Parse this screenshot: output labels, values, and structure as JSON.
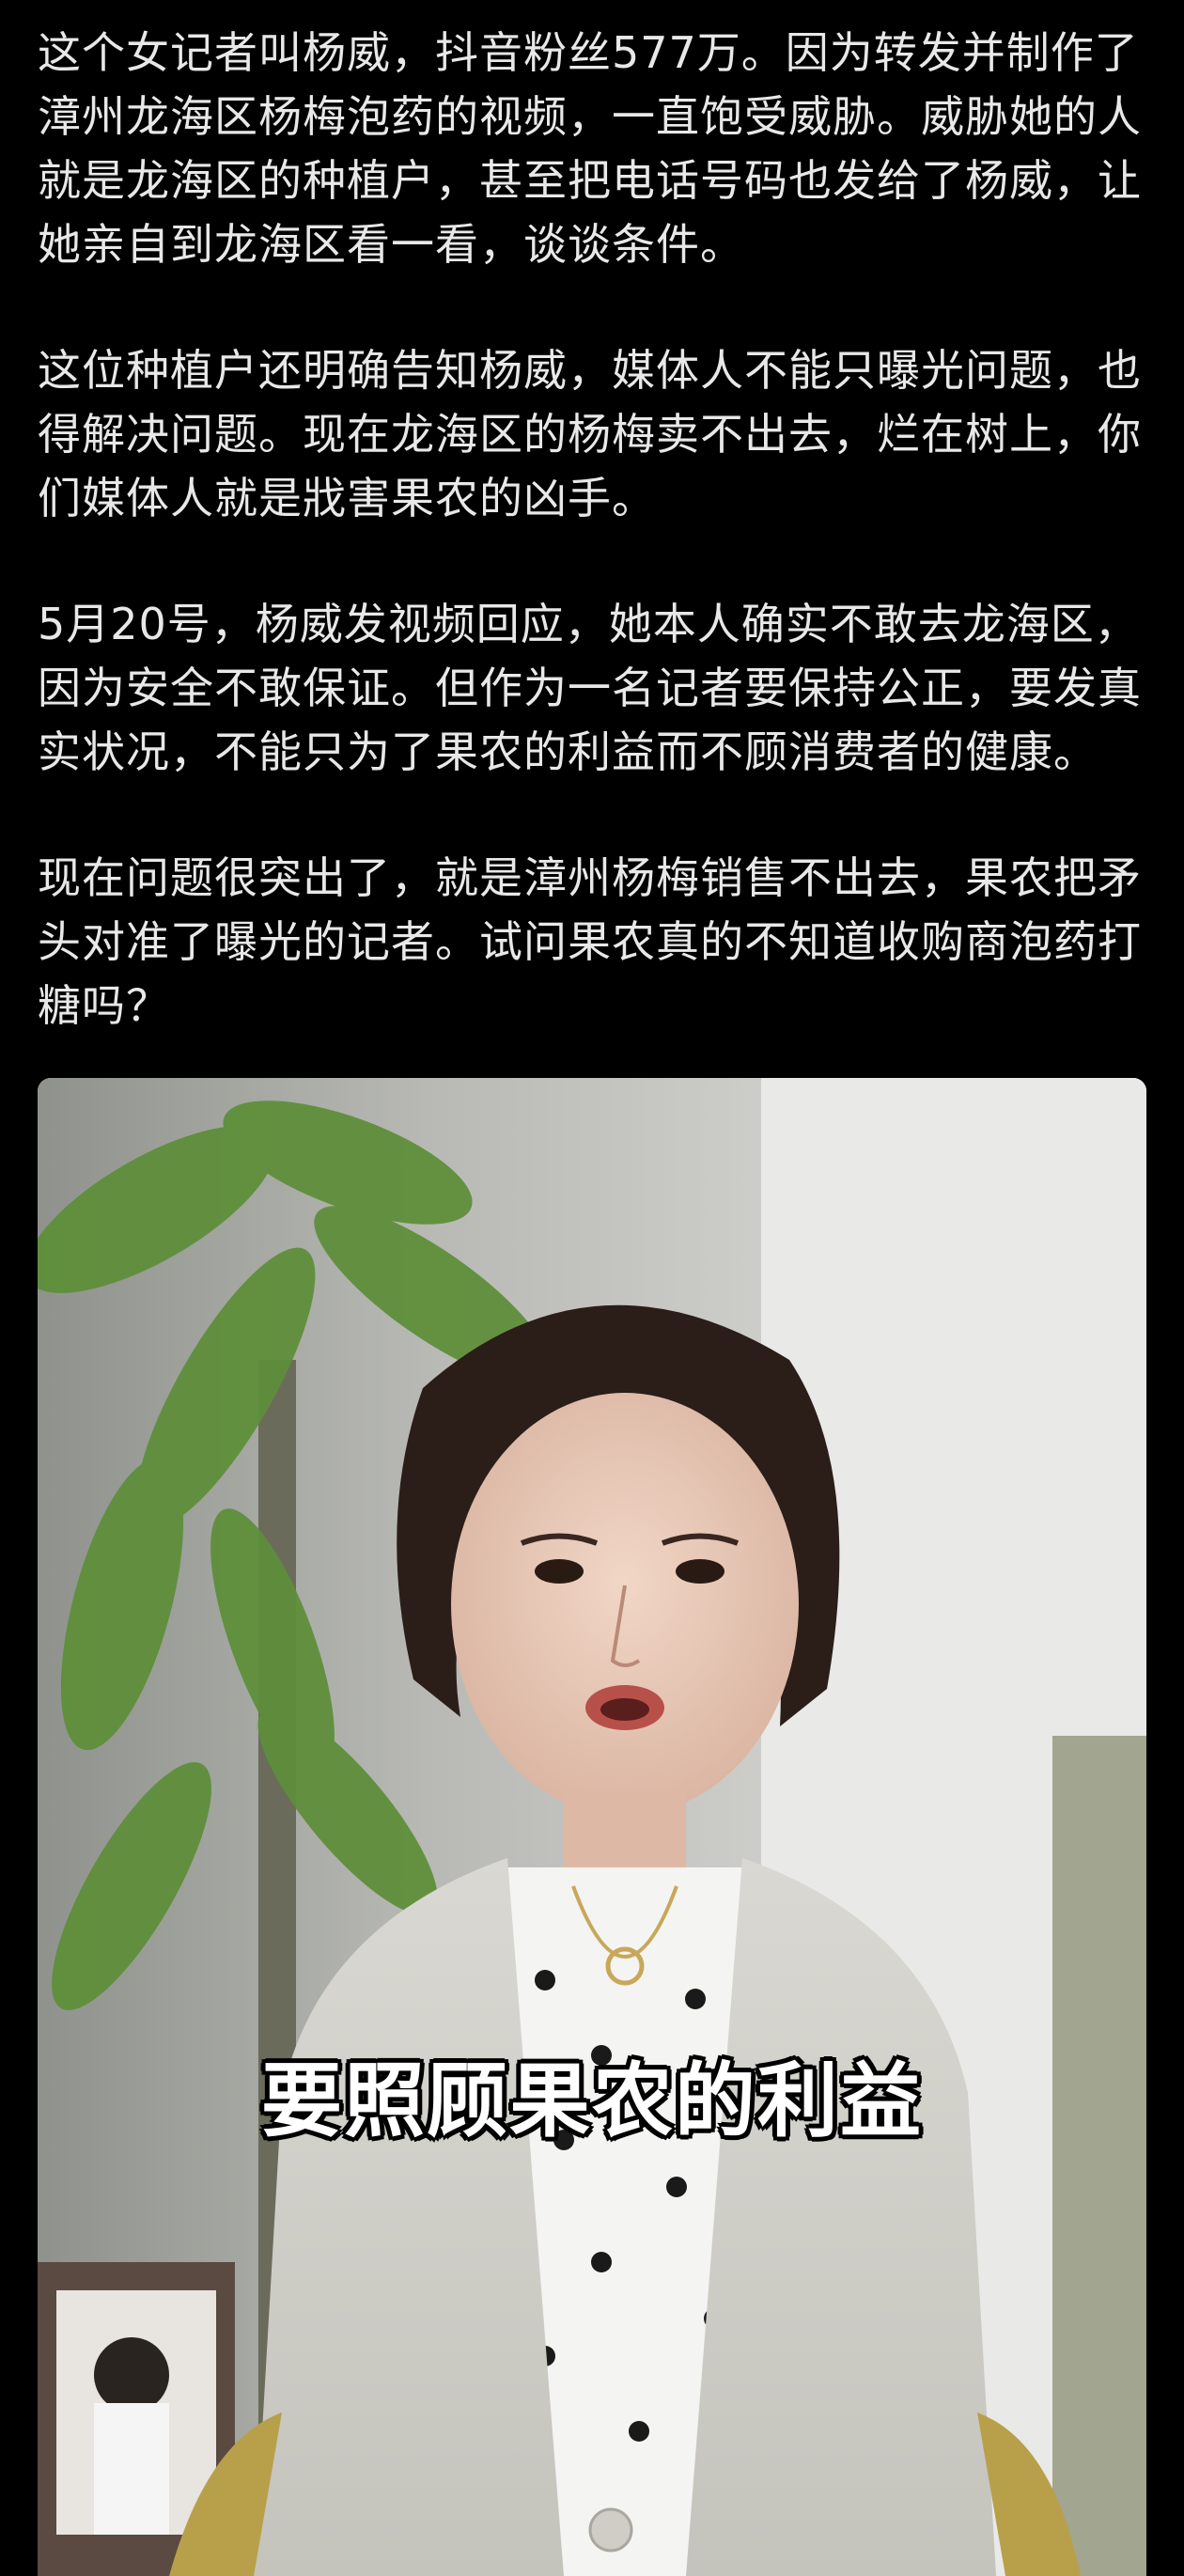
{
  "post": {
    "paragraphs": [
      "这个女记者叫杨威，抖音粉丝577万。因为转发并制作了漳州龙海区杨梅泡药的视频，一直饱受威胁。威胁她的人就是龙海区的种植户，甚至把电话号码也发给了杨威，让她亲自到龙海区看一看，谈谈条件。",
      "这位种植户还明确告知杨威，媒体人不能只曝光问题，也得解决问题。现在龙海区的杨梅卖不出去，烂在树上，你们媒体人就是戕害果农的凶手。",
      "5月20号，杨威发视频回应，她本人确实不敢去龙海区，因为安全不敢保证。但作为一名记者要保持公正，要发真实状况，不能只为了果农的利益而不顾消费者的健康。",
      "现在问题很突出了，就是漳州杨梅销售不出去，果农把矛头对准了曝光的记者。试问果农真的不知道收购商泡药打糖吗？"
    ]
  },
  "video": {
    "caption": "要照顾果农的利益"
  }
}
